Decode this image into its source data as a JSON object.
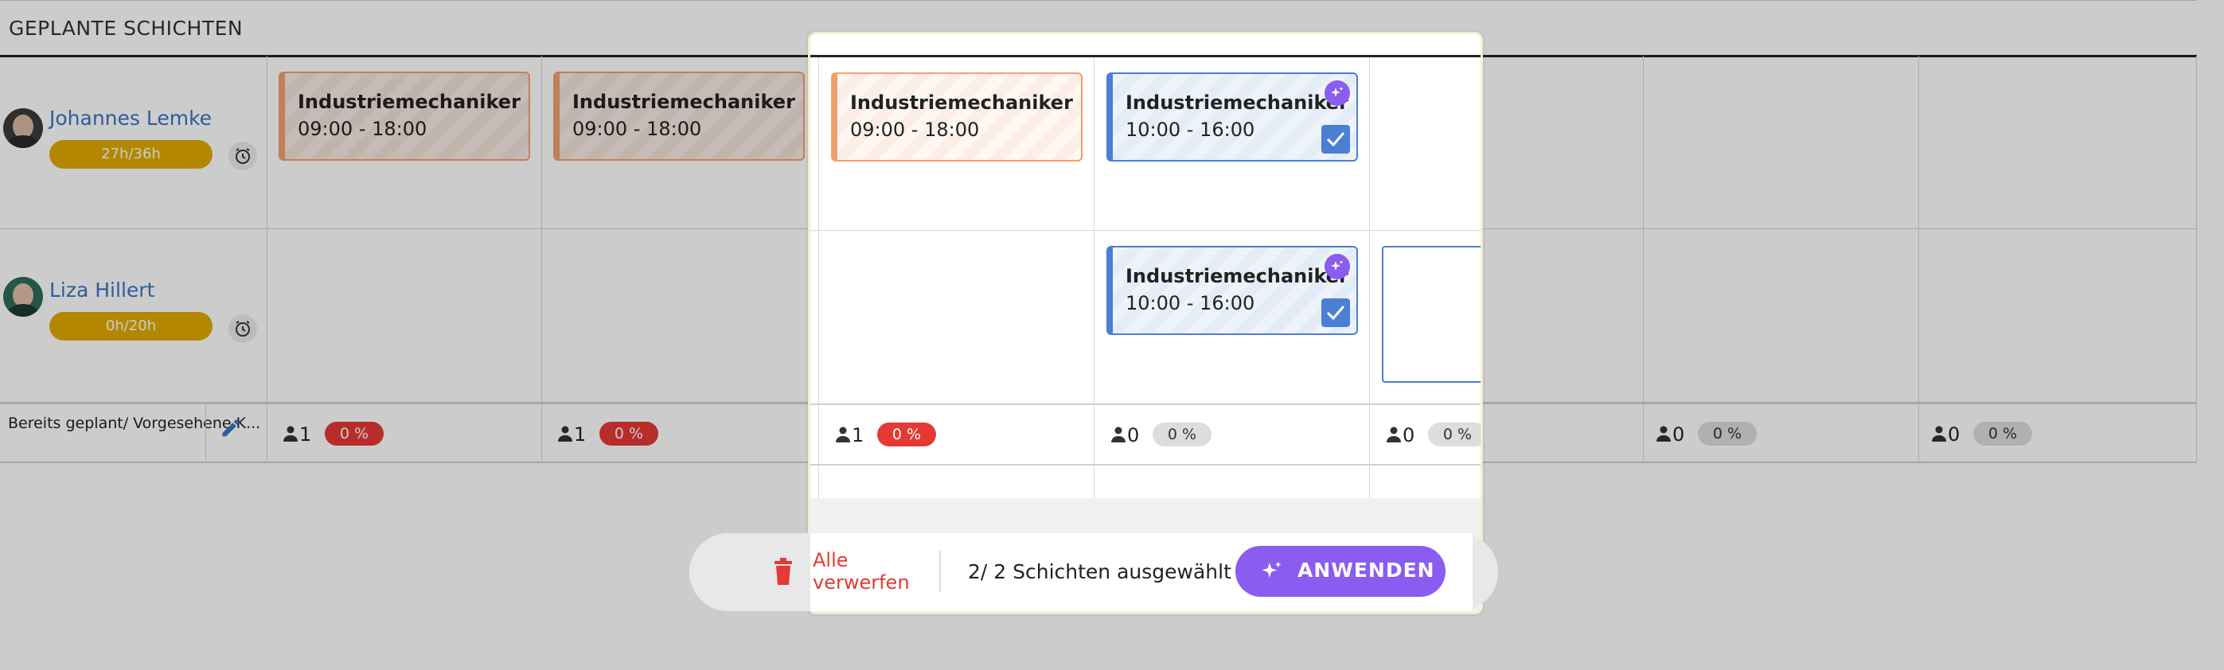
{
  "section": {
    "title": "GEPLANTE SCHICHTEN"
  },
  "employees": [
    {
      "name": "Johannes Lemke",
      "hours": "27h/36h"
    },
    {
      "name": "Liza Hillert",
      "hours": "0h/20h"
    }
  ],
  "shifts": [
    {
      "title": "Industriemechaniker",
      "time": "09:00 - 18:00"
    },
    {
      "title": "Industriemechaniker",
      "time": "09:00 - 18:00"
    },
    {
      "title": "Industriemechaniker",
      "time": "09:00 - 18:00"
    }
  ],
  "ai_shifts": [
    {
      "title": "Industriemechaniker",
      "time": "10:00 - 16:00"
    },
    {
      "title": "Industriemechaniker",
      "time": "10:00 - 16:00"
    }
  ],
  "add_shift_symbol": "+",
  "footer": {
    "label": "Bereits geplant/ Vorgesehene K...",
    "stats": [
      {
        "count": "1",
        "percent": "0 %"
      },
      {
        "count": "1",
        "percent": "0 %"
      },
      {
        "count": "1",
        "percent": "0 %"
      },
      {
        "count": "0",
        "percent": "0 %"
      },
      {
        "count": "0",
        "percent": "0 %"
      },
      {
        "count": "0",
        "percent": "0 %"
      },
      {
        "count": "0",
        "percent": "0 %"
      }
    ]
  },
  "action_bar": {
    "discard_label": "Alle verwerfen",
    "selection_text": "2/ 2 Schichten ausgewählt",
    "apply_label": "ANWENDEN"
  },
  "colors": {
    "accent_blue": "#4a7fd4",
    "accent_purple": "#8a5cf0",
    "danger_red": "#e53935",
    "hours_yellow": "#e0aa00",
    "shift_orange": "#f0a070"
  },
  "icons": [
    "avatar",
    "alarm-clock-icon",
    "edit-icon",
    "person-icon",
    "sparkle-icon",
    "checkbox-checked-icon",
    "trash-icon",
    "plus-icon"
  ]
}
